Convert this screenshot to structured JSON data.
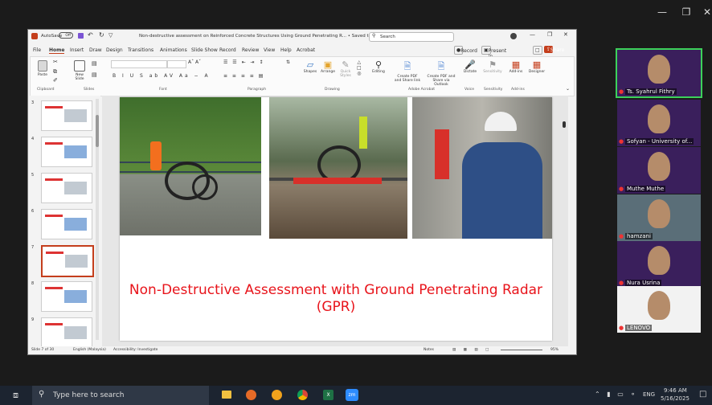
{
  "titlebar": {
    "autosave": "AutoSave",
    "autosave_state": "Off",
    "doc_title": "Non-destructive assessment on Reinforced Concrete Structures Using Ground Penetrating R... • Saved to this PC ˅",
    "search_placeholder": "Search"
  },
  "tabs": [
    "File",
    "Home",
    "Insert",
    "Draw",
    "Design",
    "Transitions",
    "Animations",
    "Slide Show",
    "Record",
    "Review",
    "View",
    "Help",
    "Acrobat"
  ],
  "tab_actions": {
    "record": "Record",
    "present": "Present in Teams",
    "share": "Share"
  },
  "ribbon": {
    "groups": [
      "Clipboard",
      "Slides",
      "Font",
      "Paragraph",
      "Drawing",
      "Adobe Acrobat",
      "Voice",
      "Sensitivity",
      "Add-ins"
    ],
    "paste": "Paste",
    "new_slide": "New Slide",
    "shapes": "Shapes",
    "arrange": "Arrange",
    "quick_styles": "Quick Styles",
    "editing": "Editing",
    "create_pdf_share": "Create PDF and Share link",
    "create_pdf_outlook": "Create PDF and Share via Outlook",
    "dictate": "Dictate",
    "sensitivity": "Sensitivity",
    "addins": "Add-ins",
    "designer": "Designer"
  },
  "thumbnails": [
    3,
    4,
    5,
    6,
    7,
    8,
    9
  ],
  "active_slide": 7,
  "slide": {
    "title_line1": "Non-Destructive Assessment with Ground Penetrating Radar",
    "title_line2": "(GPR)",
    "title_color": "#e8141b"
  },
  "statusbar": {
    "slide_info": "Slide 7 of 30",
    "language": "English (Malaysia)",
    "accessibility": "Accessibility: Investigate",
    "notes": "Notes",
    "zoom": "95%"
  },
  "participants": [
    {
      "name": "Ts. Syahrul Fithry",
      "active": true
    },
    {
      "name": "Sofyan - University of...",
      "active": false
    },
    {
      "name": "Muthe Muthe",
      "active": false
    },
    {
      "name": "hamzani",
      "active": false
    },
    {
      "name": "Nura Usrina",
      "active": false
    },
    {
      "name": "LENOVO",
      "active": false
    }
  ],
  "taskbar": {
    "search_placeholder": "Type here to search",
    "lang": "ENG",
    "time": "9:46 AM",
    "date": "5/16/2025"
  }
}
